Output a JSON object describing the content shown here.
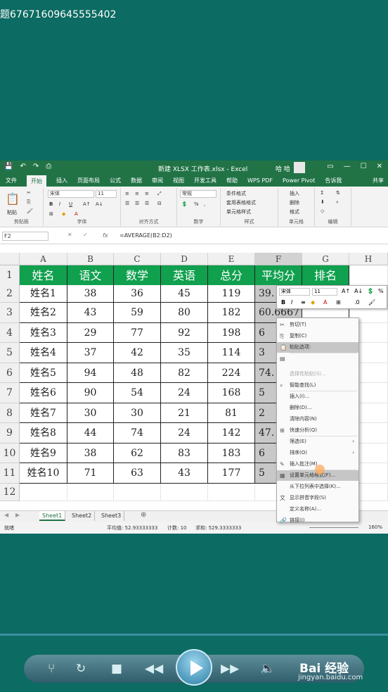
{
  "video_title": "题67671609645555402",
  "excel": {
    "doc_title": "新建 XLSX 工作表.xlsx - Excel",
    "user": "哈 哈",
    "tabs": [
      "文件",
      "开始",
      "插入",
      "页面布局",
      "公式",
      "数据",
      "审阅",
      "视图",
      "开发工具",
      "帮助",
      "WPS PDF",
      "Power Pivot",
      "告诉我"
    ],
    "active_tab": "开始",
    "share": "共享",
    "ribbon": {
      "groups": [
        "剪贴板",
        "字体",
        "对齐方式",
        "数字",
        "样式",
        "单元格",
        "编辑"
      ],
      "font_name": "宋体",
      "font_size": "11",
      "number_format": "常规",
      "paste": "粘贴",
      "styles": [
        "条件格式",
        "套用表格格式",
        "单元格样式"
      ],
      "cells": [
        "插入",
        "删除",
        "格式"
      ]
    },
    "name_box": "F2",
    "formula": "=AVERAGE(B2:D2)",
    "columns": [
      "A",
      "B",
      "C",
      "D",
      "E",
      "F",
      "G",
      "H"
    ],
    "rows": [
      "1",
      "2",
      "3",
      "4",
      "5",
      "6",
      "7",
      "8",
      "9",
      "10",
      "11",
      "12"
    ],
    "header_row": [
      "姓名",
      "语文",
      "数学",
      "英语",
      "总分",
      "平均分",
      "排名"
    ],
    "data": [
      [
        "姓名1",
        "38",
        "36",
        "45",
        "119",
        "39."
      ],
      [
        "姓名2",
        "43",
        "59",
        "80",
        "182",
        "60.6667"
      ],
      [
        "姓名3",
        "29",
        "77",
        "92",
        "198",
        "6"
      ],
      [
        "姓名4",
        "37",
        "42",
        "35",
        "114",
        "3"
      ],
      [
        "姓名5",
        "94",
        "48",
        "82",
        "224",
        "74."
      ],
      [
        "姓名6",
        "90",
        "54",
        "24",
        "168",
        "5"
      ],
      [
        "姓名7",
        "30",
        "30",
        "21",
        "81",
        "2"
      ],
      [
        "姓名8",
        "44",
        "74",
        "24",
        "142",
        "47."
      ],
      [
        "姓名9",
        "38",
        "62",
        "83",
        "183",
        "6"
      ],
      [
        "姓名10",
        "71",
        "63",
        "43",
        "177",
        "5"
      ]
    ],
    "sheets": [
      "Sheet1",
      "Sheet2",
      "Sheet3"
    ],
    "active_sheet": "Sheet1",
    "status": {
      "mode": "就绪",
      "average": "平均值: 52.93333333",
      "count": "计数: 10",
      "sum": "求和: 529.3333333",
      "zoom": "160%"
    },
    "mini_toolbar": {
      "font": "宋体",
      "size": "11"
    },
    "context_menu": [
      {
        "icon": "cut-icon",
        "glyph": "✂",
        "label": "剪切(T)"
      },
      {
        "icon": "copy-icon",
        "glyph": "⎘",
        "label": "复制(C)"
      },
      {
        "icon": "paste-icon",
        "glyph": "📋",
        "label": "粘贴选项:",
        "highlight": true
      },
      {
        "icon": "paste-icon",
        "glyph": "▤",
        "label": ""
      },
      {
        "icon": "",
        "glyph": "",
        "label": "选择性粘贴(S)...",
        "dim": true
      },
      {
        "icon": "search-icon",
        "glyph": "⌕",
        "label": "智能查找(L)"
      },
      {
        "icon": "",
        "glyph": "",
        "label": "插入(I)..."
      },
      {
        "icon": "",
        "glyph": "",
        "label": "删除(D)..."
      },
      {
        "icon": "",
        "glyph": "",
        "label": "清除内容(N)"
      },
      {
        "icon": "quick-analysis-icon",
        "glyph": "⊞",
        "label": "快速分析(Q)"
      },
      {
        "icon": "",
        "glyph": "",
        "label": "筛选(E)",
        "submenu": true
      },
      {
        "icon": "",
        "glyph": "",
        "label": "排序(O)",
        "submenu": true
      },
      {
        "icon": "comment-icon",
        "glyph": "✎",
        "label": "插入批注(M)"
      },
      {
        "icon": "format-cells-icon",
        "glyph": "▦",
        "label": "设置单元格格式(F)...",
        "highlight": true
      },
      {
        "icon": "",
        "glyph": "",
        "label": "从下拉列表中选择(K)..."
      },
      {
        "icon": "phonetic-icon",
        "glyph": "文",
        "label": "显示拼音字段(S)"
      },
      {
        "icon": "",
        "glyph": "",
        "label": "定义名称(A)..."
      },
      {
        "icon": "link-icon",
        "glyph": "🔗",
        "label": "链接(I)"
      }
    ]
  },
  "watermark": {
    "brand": "Bai 经验",
    "url": "jingyan.baidu.com"
  }
}
